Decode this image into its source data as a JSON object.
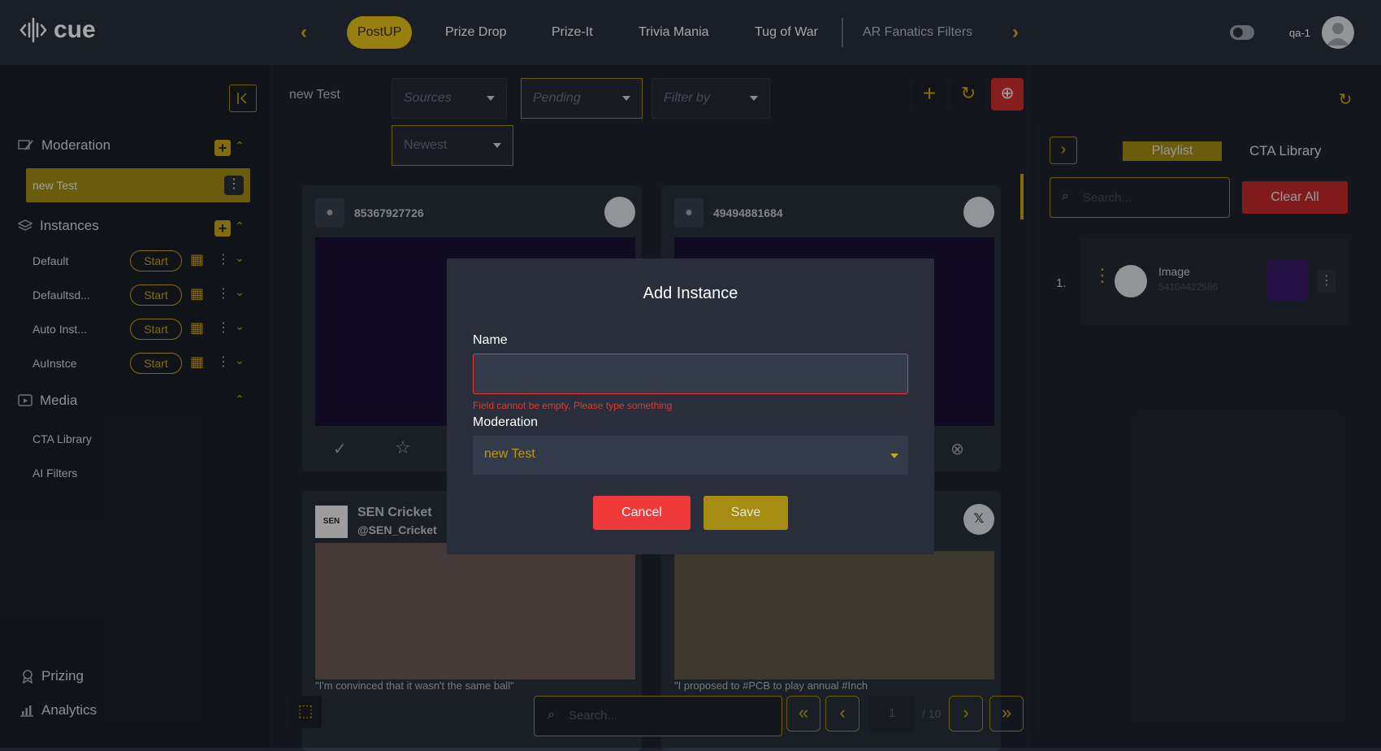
{
  "app": {
    "logo_text": "cue",
    "user": "qa-1"
  },
  "top_tabs": [
    {
      "label": "PostUP",
      "active": true
    },
    {
      "label": "Prize Drop"
    },
    {
      "label": "Prize-It"
    },
    {
      "label": "Trivia Mania"
    },
    {
      "label": "Tug of War"
    },
    {
      "label": "AR Fanatics Filters"
    }
  ],
  "sidebar": {
    "moderation_label": "Moderation",
    "selected_moderation": "new Test",
    "instances_label": "Instances",
    "instances": [
      {
        "name": "Default",
        "action": "Start"
      },
      {
        "name": "Defaultsd...",
        "action": "Start"
      },
      {
        "name": "Auto Inst...",
        "action": "Start"
      },
      {
        "name": "AuInstce",
        "action": "Start"
      }
    ],
    "media_label": "Media",
    "media_items": [
      "CTA Library",
      "AI Filters"
    ],
    "prizing_label": "Prizing",
    "analytics_label": "Analytics"
  },
  "main": {
    "moderation_title": "new Test",
    "filters": {
      "sources": "Sources",
      "status": "Pending",
      "filter_by": "Filter by",
      "sort": "Newest"
    },
    "cards": [
      {
        "user": "85367927726"
      },
      {
        "user": "49494881684"
      },
      {
        "user": "SEN Cricket",
        "handle": "@SEN_Cricket",
        "caption": "\"I'm convinced that it wasn't the same ball\""
      },
      {
        "caption": "\"I proposed to #PCB to play annual #Inch"
      }
    ],
    "search_placeholder": "Search...",
    "page": "1",
    "page_total": "/ 10"
  },
  "right_panel": {
    "tabs": [
      "Playlist",
      "CTA Library"
    ],
    "search_placeholder": "Search...",
    "clear_all": "Clear All",
    "items": [
      {
        "index": "1.",
        "type": "Image",
        "id": "54104422586"
      }
    ]
  },
  "modal": {
    "title": "Add Instance",
    "name_label": "Name",
    "name_value": "",
    "error": "Field cannot be empty. Please type something",
    "moderation_label": "Moderation",
    "moderation_value": "new Test",
    "cancel": "Cancel",
    "save": "Save"
  },
  "colors": {
    "accent": "#c9a614",
    "danger": "#e53935",
    "bg": "#1d222c"
  }
}
